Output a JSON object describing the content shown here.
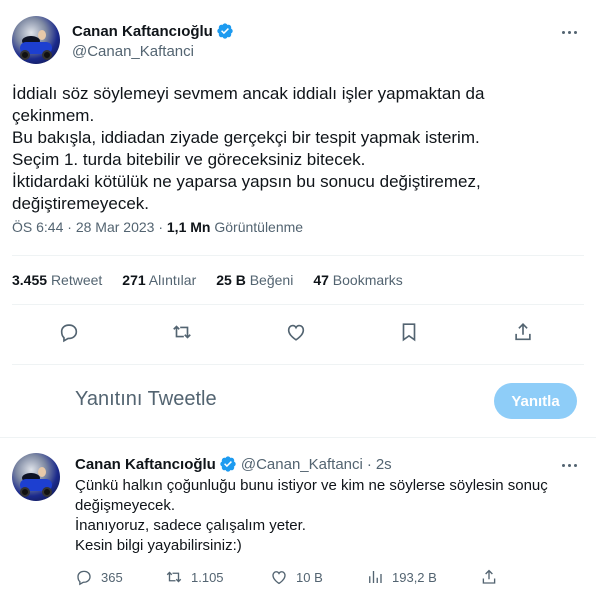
{
  "main_tweet": {
    "display_name": "Canan Kaftancıoğlu",
    "handle": "@Canan_Kaftanci",
    "text": "İddialı söz söylemeyi sevmem ancak iddialı işler yapmaktan da\nçekinmem.\nBu bakışla, iddiadan ziyade gerçekçi bir tespit yapmak isterim.\nSeçim 1. turda bitebilir ve göreceksiniz bitecek.\nİktidardaki kötülük ne yaparsa yapsın bu sonucu değiştiremez,\ndeğiştiremeyecek.",
    "time": "ÖS 6:44",
    "separator": "·",
    "date": "28 Mar 2023",
    "views_count": "1,1 Mn",
    "views_label": "Görüntülenme"
  },
  "stats": {
    "retweets_count": "3.455",
    "retweets_label": "Retweet",
    "quotes_count": "271",
    "quotes_label": "Alıntılar",
    "likes_count": "25 B",
    "likes_label": "Beğeni",
    "bookmarks_count": "47",
    "bookmarks_label": "Bookmarks"
  },
  "reply_composer": {
    "placeholder": "Yanıtını Tweetle",
    "button_label": "Yanıtla",
    "button_color": "#8ecdf8"
  },
  "reply_tweet": {
    "display_name": "Canan Kaftancıoğlu",
    "handle": "@Canan_Kaftanci",
    "separator": "·",
    "time_ago": "2s",
    "text": "Çünkü halkın çoğunluğu bunu istiyor ve kim ne söylerse söylesin sonuç\ndeğişmeyecek.\nİnanıyoruz, sadece çalışalım yeter.\nKesin bilgi yayabilirsiniz:)",
    "reply_count": "365",
    "retweet_count": "1.105",
    "like_count": "10 B",
    "view_count": "193,2 B"
  },
  "colors": {
    "verified": "#1d9bf0",
    "secondary_text": "#536471",
    "primary_text": "#0f1419"
  },
  "icons": [
    "reply-icon",
    "retweet-icon",
    "like-icon",
    "bookmark-icon",
    "share-icon",
    "views-icon",
    "verified-badge-icon",
    "more-icon"
  ]
}
